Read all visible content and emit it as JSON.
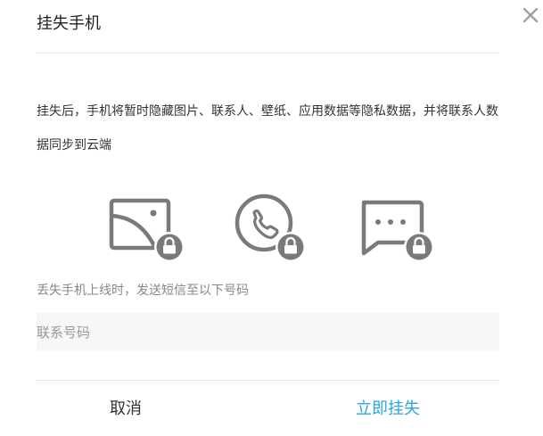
{
  "dialog": {
    "title": "挂失手机",
    "description": "挂失后，手机将暂时隐藏图片、联系人、壁纸、应用数据等隐私数据，并将联系人数据同步到云端",
    "hint": "丢失手机上线时，发送短信至以下号码",
    "phone_input": {
      "placeholder": "联系号码",
      "value": ""
    },
    "cancel_label": "取消",
    "confirm_label": "立即挂失"
  },
  "icons": {
    "close": "close-icon",
    "locked_items": [
      "image-lock-icon",
      "phone-lock-icon",
      "message-lock-icon"
    ]
  },
  "colors": {
    "accent": "#2aa7e1",
    "icon_gray": "#7a7a7a",
    "input_bg": "#f7f7f7"
  }
}
